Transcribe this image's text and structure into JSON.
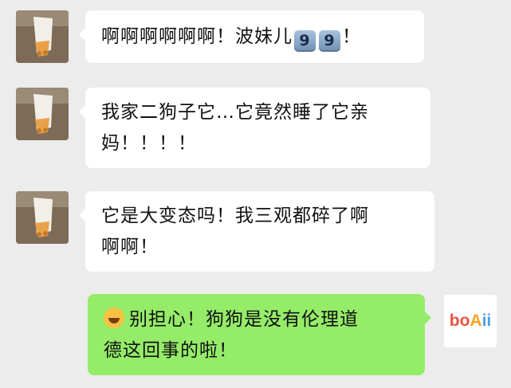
{
  "messages": [
    {
      "side": "left",
      "text": "啊啊啊啊啊啊！波妹儿",
      "suffix": "！",
      "keycaps": [
        "9",
        "9"
      ]
    },
    {
      "side": "left",
      "line1": "我家二狗子它…它竟然睡了它亲",
      "line2": "妈！！！！"
    },
    {
      "side": "left",
      "line1": "它是大变态吗！我三观都碎了啊",
      "line2": "啊啊！"
    },
    {
      "side": "right",
      "emoji": "laughing-crying-emoji",
      "line1": "别担心！狗狗是没有伦理道",
      "line2": "德这回事的啦！"
    }
  ],
  "logo": {
    "part1": "bo",
    "part2": "A",
    "part3": "ii"
  },
  "colors": {
    "background": "#ececec",
    "bubble_left": "#ffffff",
    "bubble_right": "#95ec69"
  }
}
